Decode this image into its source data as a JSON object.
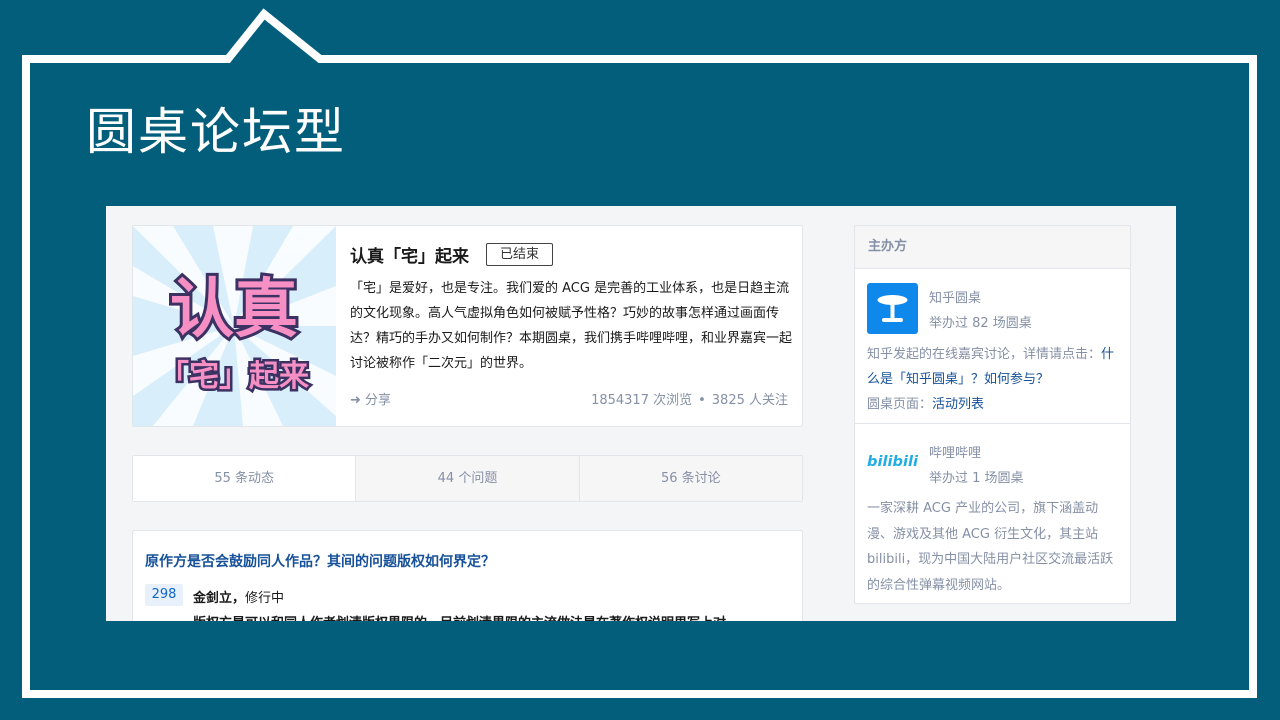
{
  "slide": {
    "title": "圆桌论坛型"
  },
  "hero": {
    "cover_text_line1": "认真",
    "cover_text_line2": "「宅」起来",
    "title": "认真「宅」起来",
    "badge": "已结束",
    "description": "「宅」是爱好，也是专注。我们爱的 ACG 是完善的工业体系，也是日趋主流的文化现象。高人气虚拟角色如何被赋予性格？巧妙的故事怎样通过画面传达？精巧的手办又如何制作？本期圆桌，我们携手哔哩哔哩，和业界嘉宾一起讨论被称作「二次元」的世界。",
    "share_label": "分享",
    "views": "1854317 次浏览",
    "followers": "3825 人关注"
  },
  "tabs": [
    {
      "label": "55 条动态"
    },
    {
      "label": "44 个问题"
    },
    {
      "label": "56 条讨论"
    }
  ],
  "question": {
    "title": "原作方是否会鼓励同人作品？其间的问题版权如何界定？",
    "votes": "298",
    "author_name": "金釗立，",
    "author_bio": "修行中",
    "excerpt": "版权方是可以和同人作者划清版权界限的，目前划清界限的主流做法是在著作权说明里写上对"
  },
  "sidebar": {
    "heading": "主办方",
    "org1": {
      "name": "知乎圆桌",
      "meta": "举办过 82 场圆桌",
      "desc_prefix": "知乎发起的在线嘉宾讨论，详情请点击：",
      "link1": "什么是「知乎圆桌」？如何参与？",
      "desc_mid": "圆桌页面：",
      "link2": "活动列表"
    },
    "org2": {
      "logo_text": "bilibili",
      "name": "哔哩哔哩",
      "meta": "举办过 1 场圆桌",
      "desc": "一家深耕 ACG 产业的公司，旗下涵盖动漫、游戏及其他 ACG 衍生文化，其主站 bilibili，现为中国大陆用户社区交流最活跃的综合性弹幕视频网站。"
    }
  },
  "colors": {
    "slide_bg": "#035e7b",
    "link_blue": "#175199",
    "brand_blue": "#0f88eb",
    "bili_blue": "#23ade5",
    "cover_pink": "#f58fc4"
  }
}
